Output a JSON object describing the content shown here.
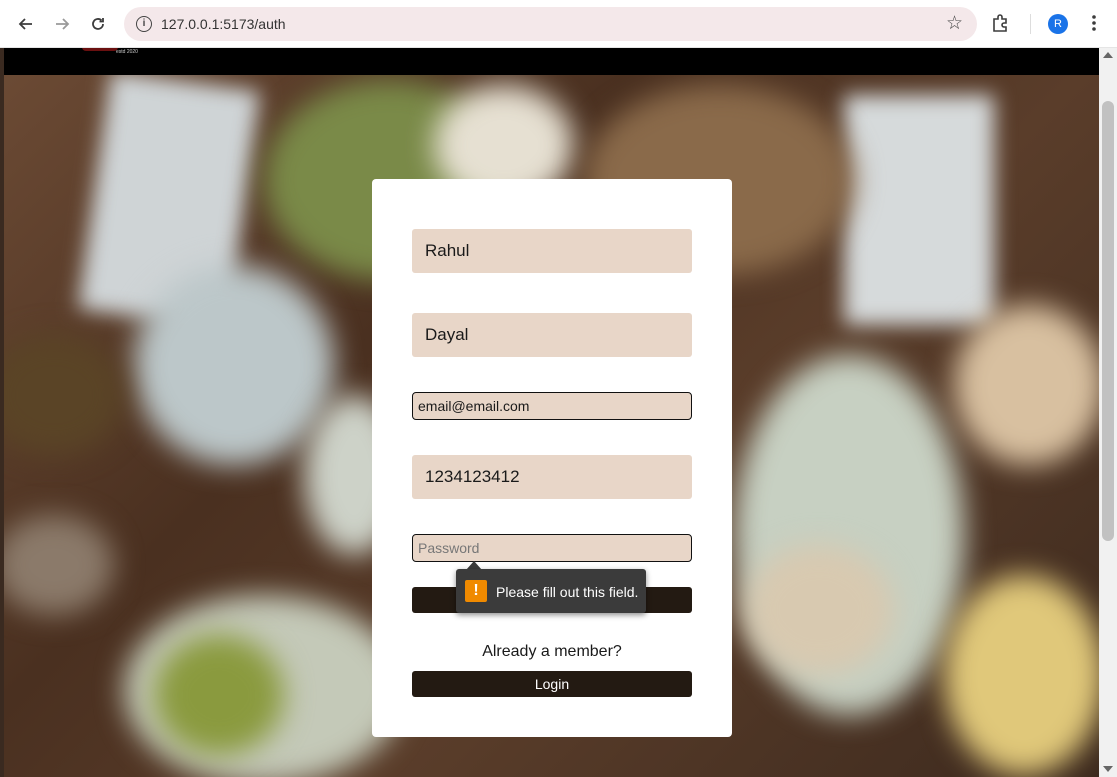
{
  "browser": {
    "url": "127.0.0.1:5173/auth",
    "profile_initial": "R",
    "accent_color": "#1a73e8"
  },
  "site": {
    "logo_tagline": "estd 2020"
  },
  "form": {
    "first_name": "Rahul",
    "last_name": "Dayal",
    "email": "email@email.com",
    "phone": "1234123412",
    "password_placeholder": "Password",
    "member_prompt": "Already a member?",
    "login_label": "Login"
  },
  "validation": {
    "message": "Please fill out this field.",
    "icon": "warning-icon"
  },
  "colors": {
    "field_bg": "#e8d6c8",
    "button_bg": "#231a12",
    "tooltip_bg": "#3b3b3b",
    "warning": "#f08a00"
  }
}
